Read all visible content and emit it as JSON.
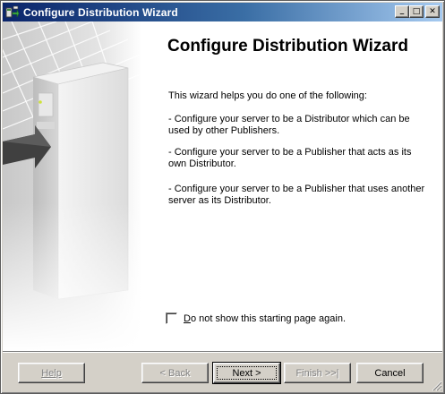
{
  "window": {
    "title": "Configure Distribution Wizard"
  },
  "title_buttons": {
    "minimize": "_",
    "maximize": "□",
    "close": "✕"
  },
  "main": {
    "heading": "Configure Distribution Wizard",
    "intro": "This wizard helps you do one of the following:",
    "options": [
      "- Configure your server to be a Distributor which can be used by other Publishers.",
      "- Configure your server to be a Publisher that acts as its own Distributor.",
      "- Configure your server to be a Publisher that uses another server as its Distributor."
    ],
    "checkbox": {
      "mnemonic": "D",
      "label_rest": "o not show this starting page again.",
      "checked": false
    }
  },
  "buttons": {
    "help": "Help",
    "back": "< Back",
    "next": "Next >",
    "finish": "Finish >>|",
    "cancel": "Cancel"
  },
  "icons": {
    "app": "wizard-app-icon",
    "illustration": "server-arrow-illustration"
  }
}
